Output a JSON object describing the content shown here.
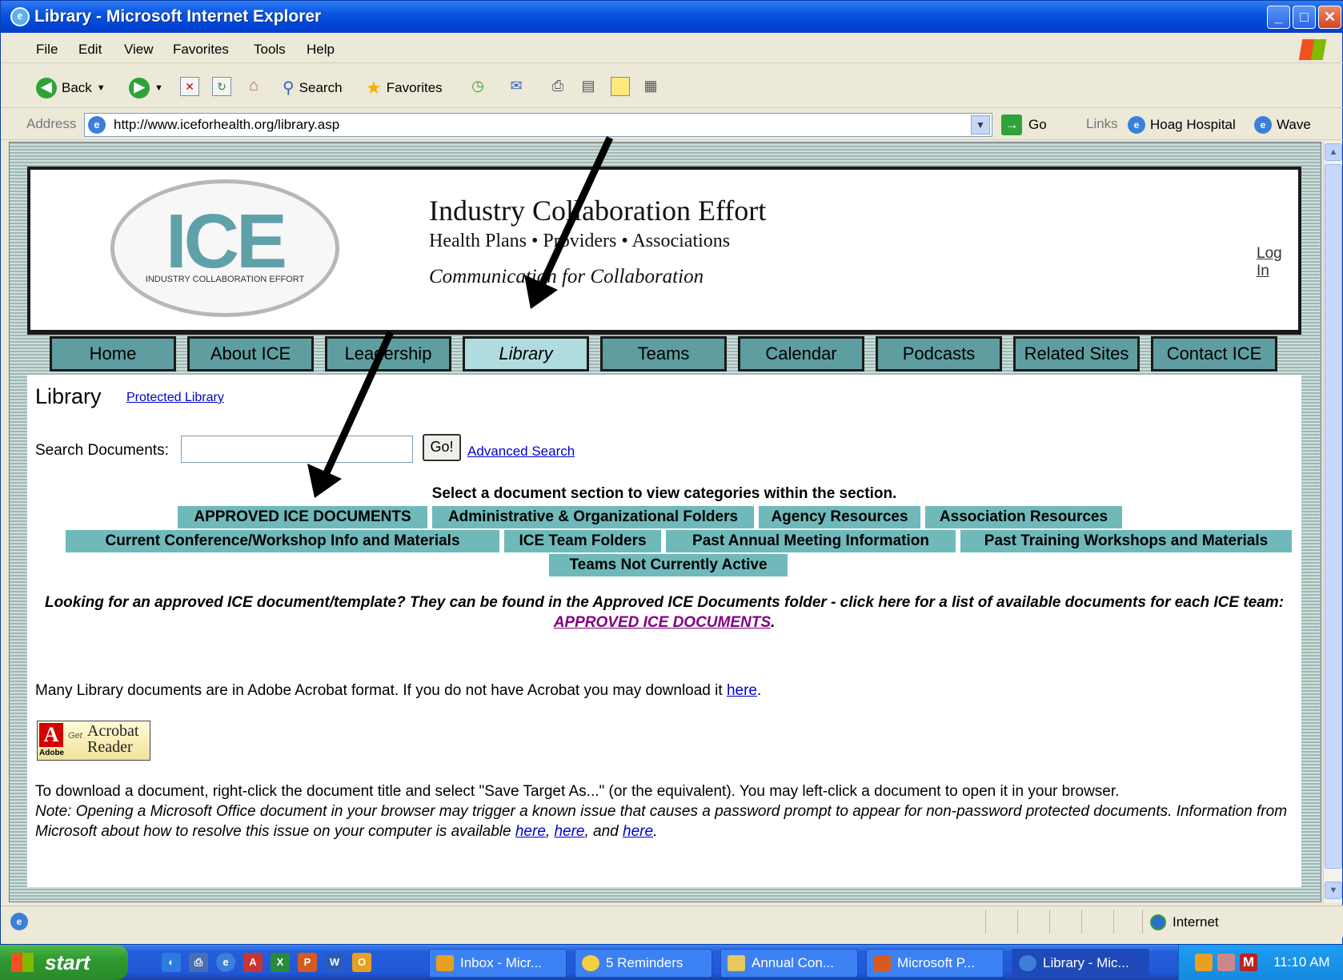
{
  "window": {
    "title": "Library - Microsoft Internet Explorer"
  },
  "menu": [
    "File",
    "Edit",
    "View",
    "Favorites",
    "Tools",
    "Help"
  ],
  "toolbar": {
    "back": "Back",
    "search": "Search",
    "favorites": "Favorites"
  },
  "address": {
    "label": "Address",
    "url": "http://www.iceforhealth.org/library.asp",
    "go": "Go",
    "links_label": "Links",
    "links": [
      "Hoag Hospital",
      "Wave"
    ]
  },
  "header": {
    "logo_big": "ICE",
    "logo_small": "INDUSTRY COLLABORATION EFFORT",
    "org": "Industry Collaboration Effort",
    "sub": "Health Plans • Providers • Associations",
    "tagline": "Communication for Collaboration",
    "login": "Log In"
  },
  "nav": [
    {
      "label": "Home"
    },
    {
      "label": "About ICE"
    },
    {
      "label": "Leadership"
    },
    {
      "label": "Library",
      "active": true
    },
    {
      "label": "Teams"
    },
    {
      "label": "Calendar"
    },
    {
      "label": "Podcasts"
    },
    {
      "label": "Related Sites"
    },
    {
      "label": "Contact ICE"
    }
  ],
  "page": {
    "title": "Library",
    "protected_link": "Protected Library",
    "search_label": "Search Documents:",
    "search_value": "",
    "go_button": "Go!",
    "advanced_link": "Advanced Search",
    "instruction": "Select a document section to view categories within the section.",
    "sections": [
      "APPROVED ICE DOCUMENTS",
      "Administrative & Organizational Folders",
      "Agency Resources",
      "Association Resources",
      "Current Conference/Workshop Info and Materials",
      "ICE Team Folders",
      "Past Annual Meeting Information",
      "Past Training Workshops and Materials",
      "Teams Not Currently Active"
    ],
    "looking_text": "Looking for an approved ICE document/template? They can be found in the Approved ICE Documents folder - click here for a list of available documents for each ICE team: ",
    "looking_link": "APPROVED ICE DOCUMENTS",
    "looking_end": ".",
    "many_text": "Many Library documents are in Adobe Acrobat format. If you do not have Acrobat you may download it ",
    "here": "here",
    "many_end": ".",
    "acrobat": {
      "get": "Get",
      "line1": "Acrobat",
      "line2": "Reader",
      "adobe": "Adobe"
    },
    "download_text": "To download a document, right-click the document title and select \"Save Target As...\" (or the equivalent). You may left-click a document to open it in your browser.",
    "note_text": "Note: Opening a Microsoft Office document in your browser may trigger a known issue that causes a password prompt to appear for non-password protected documents. Information from Microsoft about how to resolve this issue on your computer is available ",
    "note_sep1": ", ",
    "note_sep2": ", and ",
    "note_end": "."
  },
  "status": {
    "zone": "Internet"
  },
  "taskbar": {
    "start": "start",
    "tasks": [
      "Inbox - Micr...",
      "5 Reminders",
      "Annual Con...",
      "Microsoft P...",
      "Library - Mic..."
    ],
    "clock": "11:10 AM"
  },
  "colors": {
    "nav_bg": "#5f9ea0",
    "nav_active": "#b1dcdf",
    "section_bg": "#6fb9bb",
    "link": "#0000cc",
    "visited": "#800080"
  }
}
